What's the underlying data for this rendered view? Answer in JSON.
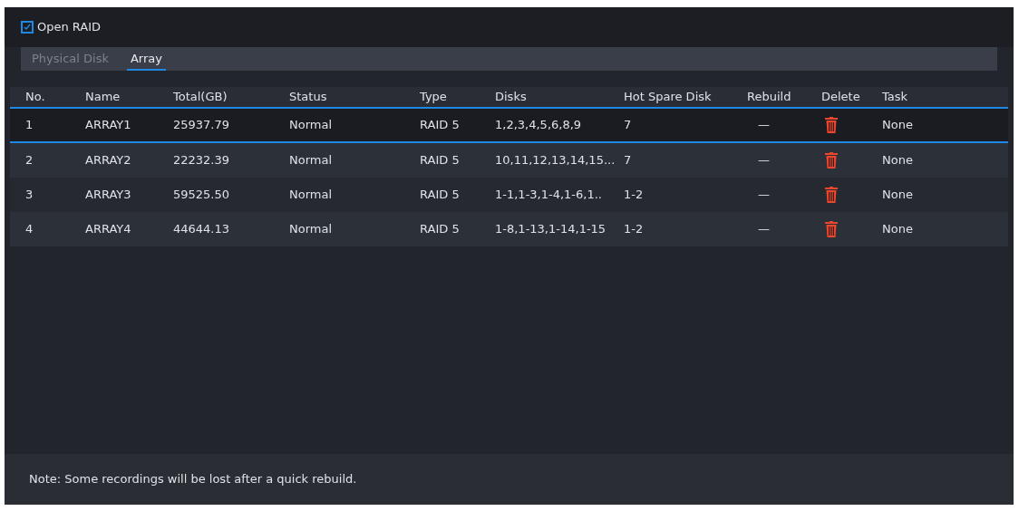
{
  "open_raid": {
    "label": "Open RAID",
    "checked": true
  },
  "tabs": [
    {
      "label": "Physical Disk",
      "selected": false
    },
    {
      "label": "Array",
      "selected": true
    }
  ],
  "table": {
    "columns": [
      "No.",
      "Name",
      "Total(GB)",
      "Status",
      "Type",
      "Disks",
      "Hot Spare Disk",
      "Rebuild",
      "Delete",
      "Task"
    ],
    "rows": [
      {
        "selected": true,
        "cells": [
          "1",
          "ARRAY1",
          "25937.79",
          "Normal",
          "RAID 5",
          "1,2,3,4,5,6,8,9",
          "7",
          "—"
        ],
        "task": "None"
      },
      {
        "selected": false,
        "cells": [
          "2",
          "ARRAY2",
          "22232.39",
          "Normal",
          "RAID 5",
          "10,11,12,13,14,15...",
          "7",
          "—"
        ],
        "task": "None"
      },
      {
        "selected": false,
        "cells": [
          "3",
          "ARRAY3",
          "59525.50",
          "Normal",
          "RAID 5",
          "1-1,1-3,1-4,1-6,1..",
          "1-2",
          "—"
        ],
        "task": "None"
      },
      {
        "selected": false,
        "cells": [
          "4",
          "ARRAY4",
          "44644.13",
          "Normal",
          "RAID 5",
          "1-8,1-13,1-14,1-15",
          "1-2",
          "—"
        ],
        "task": "None"
      }
    ]
  },
  "note": "Note: Some recordings will be lost after a quick rebuild."
}
